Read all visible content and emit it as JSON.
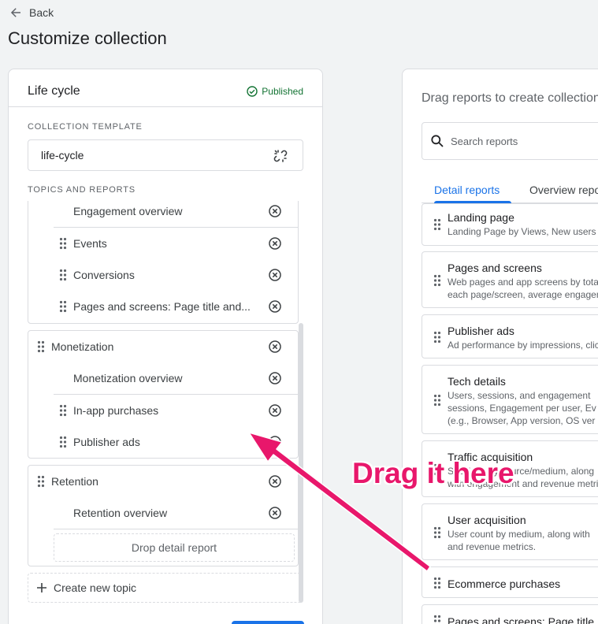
{
  "nav": {
    "back_label": "Back"
  },
  "page": {
    "title": "Customize collection"
  },
  "collection": {
    "name": "Life cycle",
    "status": "Published",
    "template_section_label": "COLLECTION TEMPLATE",
    "template_value": "life-cycle",
    "topics_section_label": "TOPICS AND REPORTS",
    "topic_engagement": {
      "items": [
        "Engagement overview",
        "Events",
        "Conversions",
        "Pages and screens: Page title and..."
      ]
    },
    "topic_monetization": {
      "name": "Monetization",
      "items": [
        "Monetization overview",
        "In-app purchases",
        "Publisher ads"
      ]
    },
    "topic_retention": {
      "name": "Retention",
      "items": [
        "Retention overview"
      ],
      "drop_label": "Drop detail report"
    },
    "create_topic_label": "Create new topic"
  },
  "library": {
    "title": "Drag reports to create collection",
    "search_placeholder": "Search reports",
    "tabs": [
      "Detail reports",
      "Overview reports"
    ],
    "reports": [
      {
        "title": "Landing page",
        "desc": [
          "Landing Page by Views, New users"
        ]
      },
      {
        "title": "Pages and screens",
        "desc": [
          "Web pages and app screens by total",
          "each page/screen, average engagement"
        ]
      },
      {
        "title": "Publisher ads",
        "desc": [
          "Ad performance by impressions, clicks"
        ]
      },
      {
        "title": "Tech details",
        "desc": [
          "Users, sessions, and engagement",
          "sessions, Engagement per user, Ev",
          "(e.g., Browser, App version, OS ver"
        ]
      },
      {
        "title": "Traffic acquisition",
        "desc": [
          "Sessions by source/medium, along",
          "with engagement and revenue metrics."
        ]
      },
      {
        "title": "User acquisition",
        "desc": [
          "User count by medium, along with",
          "and revenue metrics."
        ]
      },
      {
        "title": "Ecommerce purchases",
        "desc": []
      },
      {
        "title": "Pages and screens: Page title",
        "desc": []
      }
    ]
  },
  "annotation": {
    "text": "Drag it here",
    "color": "#e8176b"
  },
  "colors": {
    "accent": "#1a73e8",
    "success": "#137333",
    "border": "#dadce0"
  }
}
